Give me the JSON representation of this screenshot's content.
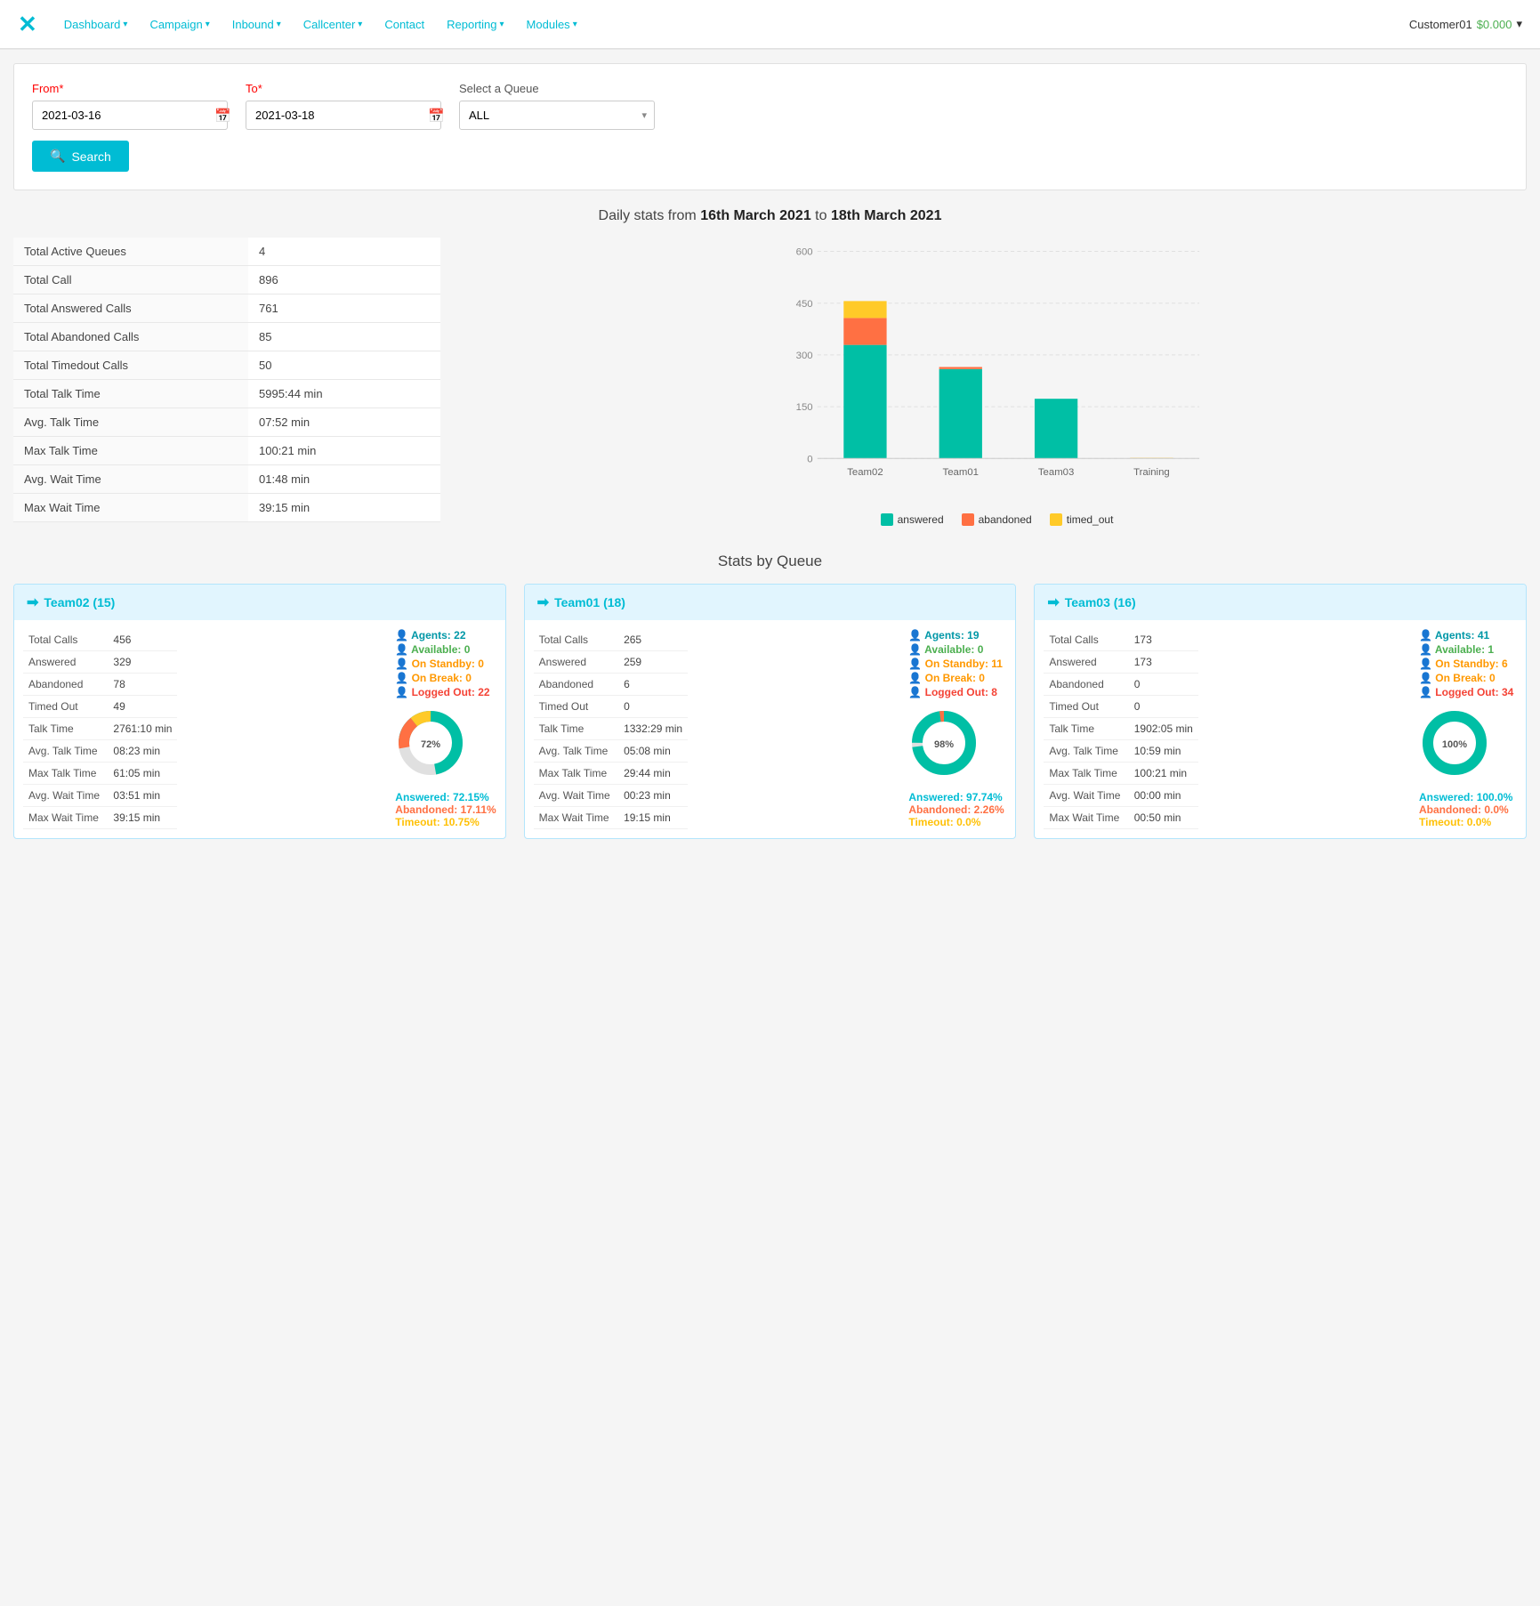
{
  "navbar": {
    "logo": "✕",
    "items": [
      {
        "label": "Dashboard",
        "hasDropdown": true
      },
      {
        "label": "Campaign",
        "hasDropdown": true
      },
      {
        "label": "Inbound",
        "hasDropdown": true
      },
      {
        "label": "Callcenter",
        "hasDropdown": true
      },
      {
        "label": "Contact",
        "hasDropdown": false
      },
      {
        "label": "Reporting",
        "hasDropdown": true
      },
      {
        "label": "Modules",
        "hasDropdown": true
      }
    ],
    "user": "Customer01",
    "balance": "$0.000",
    "chevron": "▾"
  },
  "filter": {
    "from_label": "From",
    "to_label": "To",
    "queue_label": "Select a Queue",
    "from_value": "2021-03-16",
    "to_value": "2021-03-18",
    "queue_value": "ALL",
    "search_label": "Search"
  },
  "stats_title": "Daily stats from ",
  "stats_from": "16th March 2021",
  "stats_to_text": " to ",
  "stats_to": "18th March 2021",
  "summary": {
    "rows": [
      {
        "label": "Total Active Queues",
        "value": "4"
      },
      {
        "label": "Total Call",
        "value": "896"
      },
      {
        "label": "Total Answered Calls",
        "value": "761"
      },
      {
        "label": "Total Abandoned Calls",
        "value": "85"
      },
      {
        "label": "Total Timedout Calls",
        "value": "50"
      },
      {
        "label": "Total Talk Time",
        "value": "5995:44 min"
      },
      {
        "label": "Avg. Talk Time",
        "value": "07:52 min"
      },
      {
        "label": "Max Talk Time",
        "value": "100:21 min"
      },
      {
        "label": "Avg. Wait Time",
        "value": "01:48 min"
      },
      {
        "label": "Max Wait Time",
        "value": "39:15 min"
      }
    ]
  },
  "chart": {
    "max_y": 600,
    "y_labels": [
      "0",
      "150",
      "300",
      "450",
      "600"
    ],
    "bars": [
      {
        "label": "Team02",
        "answered": 329,
        "abandoned": 78,
        "timed_out": 49
      },
      {
        "label": "Team01",
        "answered": 259,
        "abandoned": 6,
        "timed_out": 0
      },
      {
        "label": "Team03",
        "answered": 173,
        "abandoned": 0,
        "timed_out": 0
      },
      {
        "label": "Training",
        "answered": 0,
        "abandoned": 1,
        "timed_out": 1
      }
    ],
    "legend": [
      {
        "label": "answered",
        "color": "#00bfa5"
      },
      {
        "label": "abandoned",
        "color": "#ff7043"
      },
      {
        "label": "timed_out",
        "color": "#ffca28"
      }
    ]
  },
  "queue_section_title": "Stats by Queue",
  "queues": [
    {
      "name": "Team02",
      "count": 15,
      "stats": [
        {
          "label": "Total Calls",
          "value": "456"
        },
        {
          "label": "Answered",
          "value": "329"
        },
        {
          "label": "Abandoned",
          "value": "78"
        },
        {
          "label": "Timed Out",
          "value": "49"
        },
        {
          "label": "Talk Time",
          "value": "2761:10 min"
        },
        {
          "label": "Avg. Talk Time",
          "value": "08:23 min"
        },
        {
          "label": "Max Talk Time",
          "value": "61:05 min"
        },
        {
          "label": "Avg. Wait Time",
          "value": "03:51 min"
        },
        {
          "label": "Max Wait Time",
          "value": "39:15 min"
        }
      ],
      "agents_total": 22,
      "available": 0,
      "on_standby": 0,
      "on_break": 0,
      "logged_out": 22,
      "donut": {
        "answered_pct": 72.15,
        "abandoned_pct": 17.11,
        "timeout_pct": 10.75
      },
      "answered_label": "Answered: 72.15%",
      "abandoned_label": "Abandoned: 17.11%",
      "timeout_label": "Timeout: 10.75%"
    },
    {
      "name": "Team01",
      "count": 18,
      "stats": [
        {
          "label": "Total Calls",
          "value": "265"
        },
        {
          "label": "Answered",
          "value": "259"
        },
        {
          "label": "Abandoned",
          "value": "6"
        },
        {
          "label": "Timed Out",
          "value": "0"
        },
        {
          "label": "Talk Time",
          "value": "1332:29 min"
        },
        {
          "label": "Avg. Talk Time",
          "value": "05:08 min"
        },
        {
          "label": "Max Talk Time",
          "value": "29:44 min"
        },
        {
          "label": "Avg. Wait Time",
          "value": "00:23 min"
        },
        {
          "label": "Max Wait Time",
          "value": "19:15 min"
        }
      ],
      "agents_total": 19,
      "available": 0,
      "on_standby": 11,
      "on_break": 0,
      "logged_out": 8,
      "donut": {
        "answered_pct": 97.74,
        "abandoned_pct": 2.26,
        "timeout_pct": 0.0
      },
      "answered_label": "Answered: 97.74%",
      "abandoned_label": "Abandoned: 2.26%",
      "timeout_label": "Timeout: 0.0%"
    },
    {
      "name": "Team03",
      "count": 16,
      "stats": [
        {
          "label": "Total Calls",
          "value": "173"
        },
        {
          "label": "Answered",
          "value": "173"
        },
        {
          "label": "Abandoned",
          "value": "0"
        },
        {
          "label": "Timed Out",
          "value": "0"
        },
        {
          "label": "Talk Time",
          "value": "1902:05 min"
        },
        {
          "label": "Avg. Talk Time",
          "value": "10:59 min"
        },
        {
          "label": "Max Talk Time",
          "value": "100:21 min"
        },
        {
          "label": "Avg. Wait Time",
          "value": "00:00 min"
        },
        {
          "label": "Max Wait Time",
          "value": "00:50 min"
        }
      ],
      "agents_total": 41,
      "available": 1,
      "on_standby": 6,
      "on_break": 0,
      "logged_out": 34,
      "donut": {
        "answered_pct": 100.0,
        "abandoned_pct": 0.0,
        "timeout_pct": 0.0
      },
      "answered_label": "Answered: 100.0%",
      "abandoned_label": "Abandoned: 0.0%",
      "timeout_label": "Timeout: 0.0%"
    }
  ]
}
